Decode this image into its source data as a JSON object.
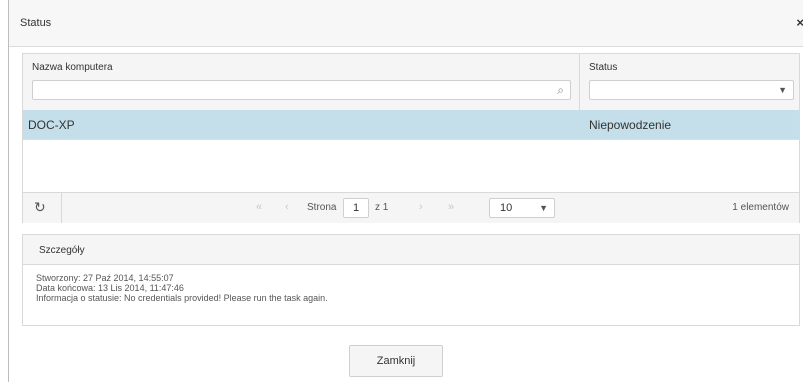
{
  "dialog": {
    "title": "Status",
    "close_glyph": "×"
  },
  "grid": {
    "columns": [
      {
        "label": "Nazwa komputera",
        "filter_value": ""
      },
      {
        "label": "Status",
        "filter_value": ""
      }
    ],
    "rows": [
      {
        "computer": "DOC-XP",
        "status": "Niepowodzenie",
        "selected": true
      }
    ],
    "icons": {
      "search": "search-icon",
      "dropdown": "chevron-down-icon",
      "refresh": "refresh-icon"
    }
  },
  "pager": {
    "first": "«",
    "prev": "‹",
    "page_label": "Strona",
    "page": "1",
    "of_label": "z 1",
    "next": "›",
    "last": "»",
    "page_size": "10",
    "count": "1 elementów"
  },
  "details": {
    "title": "Szczegóły",
    "created": "Stworzony: 27 Paź 2014, 14:55:07",
    "end_date": "Data końcowa: 13 Lis 2014, 11:47:46",
    "info": "Informacja o statusie: No credentials provided! Please run the task again."
  },
  "footer": {
    "close_label": "Zamknij"
  },
  "colors": {
    "selected_row": "#c4dfea",
    "header_bg": "#f5f5f5",
    "border": "#d9d9d9"
  }
}
